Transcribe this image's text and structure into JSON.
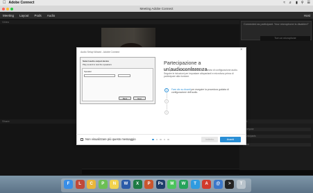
{
  "menubar": {
    "apple": "",
    "app_name": "Adobe Connect",
    "status": "WiFi, volume, battery, clock"
  },
  "window": {
    "title": "Meeting Adobe Connect",
    "traffic_colors": [
      "#ff5f57",
      "#febc2e",
      "#28c840"
    ]
  },
  "toolbar": {
    "items": [
      "Meeting",
      "Layout",
      "Pods",
      "Audio"
    ],
    "right_label": "Host"
  },
  "pods": {
    "video_title": "Video",
    "lower_title": "Share",
    "chat_title": "Chat",
    "chat_rows": [
      "Everyone",
      "Participants",
      "Host"
    ]
  },
  "notice": {
    "text": "Connected as participant. Your microphone is disabled.",
    "button_label": "Turn on microphone"
  },
  "modal": {
    "mini_title": "Audio Setup Wizard - Adobe Connect",
    "mini_heading": "Select audio output device",
    "mini_line1": "Play sound to test the speakers",
    "mini_line2": "Speaker",
    "mini_btn_back": "Back",
    "mini_btn_next": "Next",
    "title": "Partecipazione a un'audioconferenza",
    "body": "Nel riquadro a sinistra è visualizzata la finestra di configurazione audio. Seguire le istruzioni per impostare altoparlanti e microfono prima di partecipare alla riunione.",
    "step1_number": "1",
    "step1_link": "Fare clic su Avanti",
    "step1_text": "per eseguire la procedura guidata di configurazione dell'audio.",
    "step2_number": "2",
    "step3_number": "3",
    "checkbox_label": "Non visualizzare più questo messaggio",
    "btn_prev": "Indietro",
    "btn_next": "Avanti",
    "close_label": "×"
  },
  "dock": {
    "apps": [
      {
        "name": "Finder",
        "color": "#3a8ee6",
        "glyph": "F"
      },
      {
        "name": "Launchpad",
        "color": "#c04a3a",
        "glyph": "L"
      },
      {
        "name": "Chrome",
        "color": "#e9b63a",
        "glyph": "C"
      },
      {
        "name": "Photos",
        "color": "#6cbf55",
        "glyph": "P"
      },
      {
        "name": "Notes",
        "color": "#f2d34e",
        "glyph": "N"
      },
      {
        "name": "Word",
        "color": "#2b5ba8",
        "glyph": "W"
      },
      {
        "name": "Excel",
        "color": "#1e7b44",
        "glyph": "X"
      },
      {
        "name": "PowerPoint",
        "color": "#c9562f",
        "glyph": "P"
      },
      {
        "name": "Photoshop",
        "color": "#1d3d6a",
        "glyph": "Ps"
      },
      {
        "name": "Messages",
        "color": "#4cc45e",
        "glyph": "M"
      },
      {
        "name": "WhatsApp",
        "color": "#25a35a",
        "glyph": "W"
      },
      {
        "name": "Telegram",
        "color": "#2f9be0",
        "glyph": "T"
      },
      {
        "name": "Connect",
        "color": "#d13a2c",
        "glyph": "A"
      },
      {
        "name": "Mail",
        "color": "#3b77c9",
        "glyph": "@"
      },
      {
        "name": "Terminal",
        "color": "#222222",
        "glyph": ">"
      },
      {
        "name": "Trash",
        "color": "#b9c4cc",
        "glyph": "T"
      }
    ]
  }
}
